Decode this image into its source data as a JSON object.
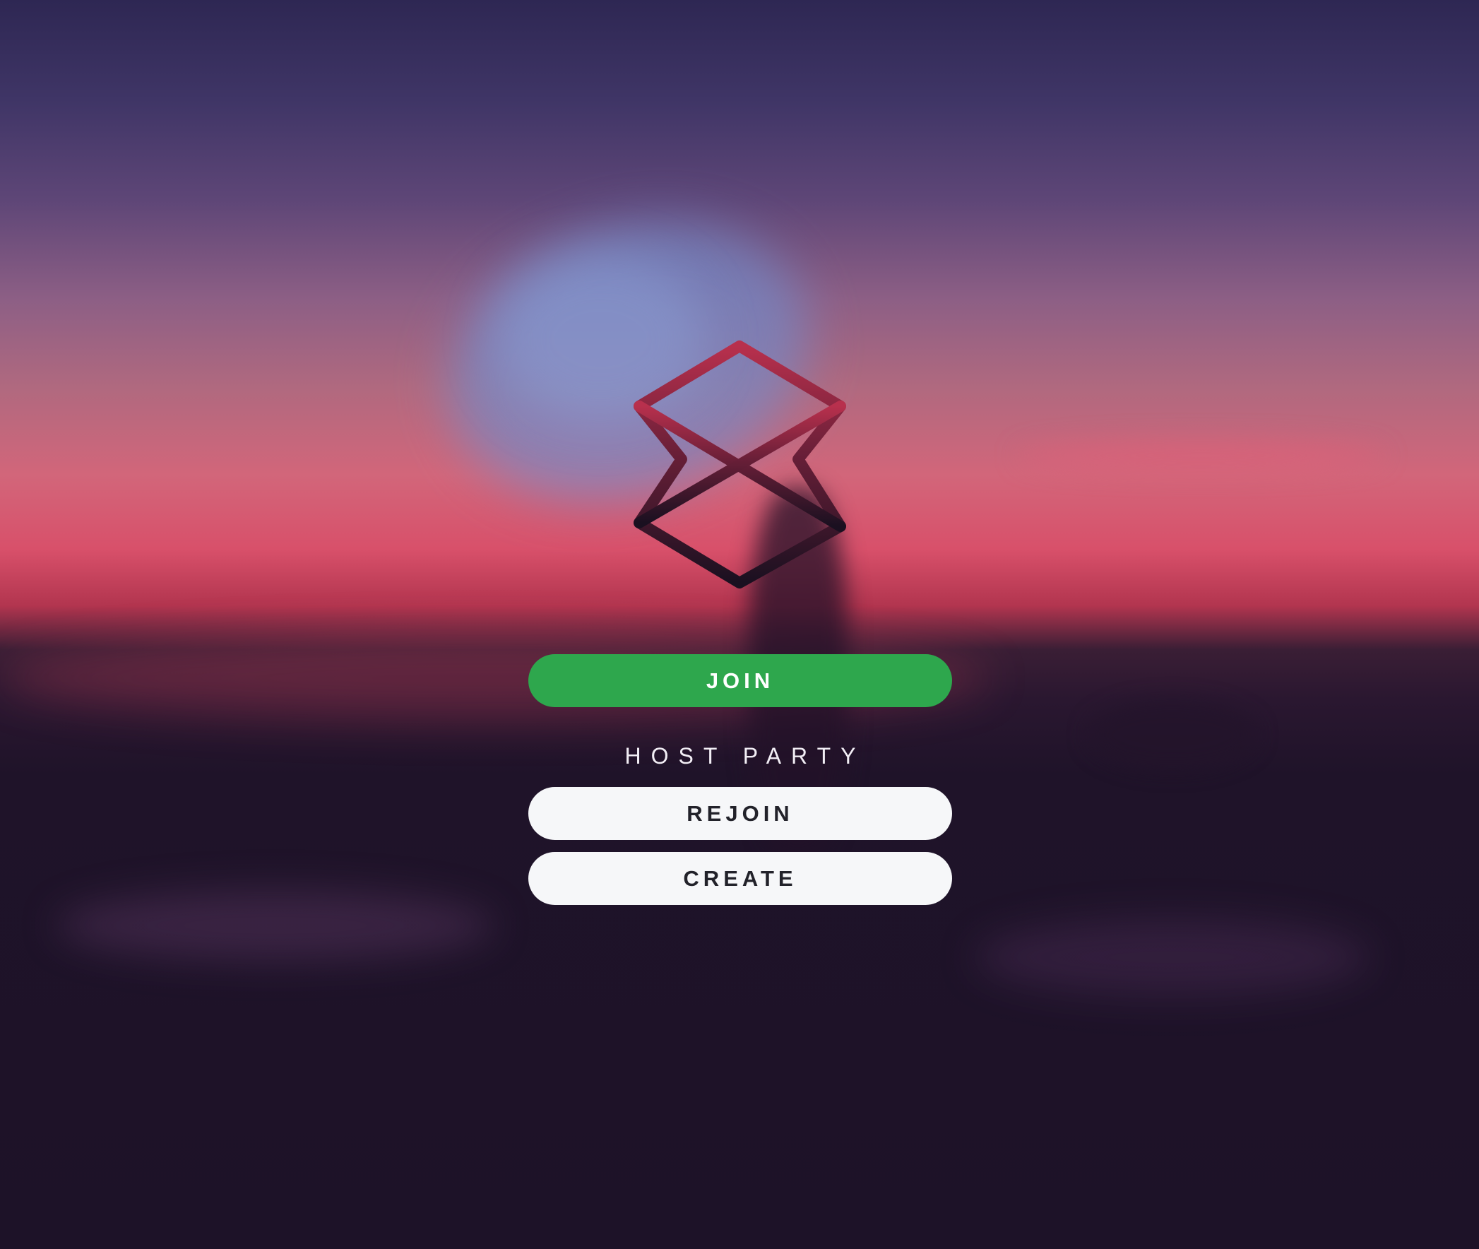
{
  "app": {
    "logo_icon": "zune-logo-icon",
    "colors": {
      "join_button": "#2ea74d",
      "secondary_button": "#f6f7f9",
      "logo_top": "#b8304d",
      "logo_bottom": "#1a1020"
    }
  },
  "actions": {
    "join_label": "JOIN"
  },
  "host_party": {
    "heading": "HOST PARTY",
    "rejoin_label": "REJOIN",
    "create_label": "CREATE"
  }
}
